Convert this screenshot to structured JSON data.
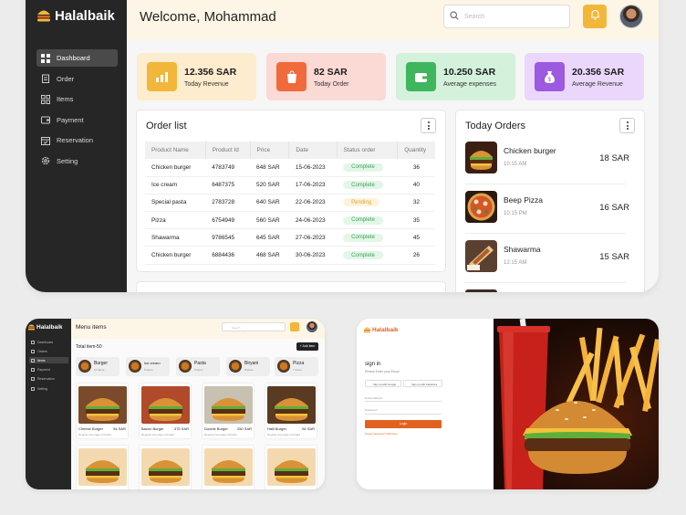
{
  "brand": {
    "name": "Halalbaik",
    "accent": "#f2b73a",
    "orange": "#e0621e"
  },
  "sidebar": {
    "items": [
      {
        "label": "Dashboard",
        "icon": "grid-icon",
        "active": true
      },
      {
        "label": "Order",
        "icon": "clipboard-icon"
      },
      {
        "label": "Items",
        "icon": "items-grid-icon"
      },
      {
        "label": "Payment",
        "icon": "wallet-icon"
      },
      {
        "label": "Reservation",
        "icon": "calendar-icon"
      },
      {
        "label": "Setting",
        "icon": "gear-icon"
      }
    ]
  },
  "header": {
    "welcome": "Welcome, Mohammad",
    "search_placeholder": "Search"
  },
  "stats": [
    {
      "value": "12.356 SAR",
      "label": "Today Revenue",
      "bg": "#fdeccd",
      "icon_bg": "#f2b73a"
    },
    {
      "value": "82 SAR",
      "label": "Today Order",
      "bg": "#fbd9d5",
      "icon_bg": "#f06a3c"
    },
    {
      "value": "10.250 SAR",
      "label": "Average expenses",
      "bg": "#d3f1db",
      "icon_bg": "#3fb55d"
    },
    {
      "value": "20.356 SAR",
      "label": "Average Revenue",
      "bg": "#ead7fb",
      "icon_bg": "#9b5ae0"
    }
  ],
  "order_list": {
    "title": "Order list",
    "columns": [
      "Product Name",
      "Product Id",
      "Price",
      "Date",
      "Status order",
      "Quantity"
    ],
    "rows": [
      {
        "name": "Chicken burger",
        "id": "4783749",
        "price": "648 SAR",
        "date": "15-06-2023",
        "status": "Complete",
        "qty": "36"
      },
      {
        "name": "Ice cream",
        "id": "6487375",
        "price": "520 SAR",
        "date": "17-06-2023",
        "status": "Complete",
        "qty": "40"
      },
      {
        "name": "Special pasta",
        "id": "2783728",
        "price": "640 SAR",
        "date": "22-06-2023",
        "status": "Pending",
        "qty": "32"
      },
      {
        "name": "Pizza",
        "id": "6754949",
        "price": "560 SAR",
        "date": "24-06-2023",
        "status": "Complete",
        "qty": "35"
      },
      {
        "name": "Shawarma",
        "id": "9786545",
        "price": "645 SAR",
        "date": "27-06-2023",
        "status": "Complete",
        "qty": "45"
      },
      {
        "name": "Chicken burger",
        "id": "6884436",
        "price": "468 SAR",
        "date": "30-06-2023",
        "status": "Complete",
        "qty": "26"
      }
    ]
  },
  "today_orders": {
    "title": "Today Orders",
    "items": [
      {
        "name": "Chicken burger",
        "time": "10:15 AM",
        "price": "18 SAR"
      },
      {
        "name": "Beep Pizza",
        "time": "10:15 PM",
        "price": "16 SAR"
      },
      {
        "name": "Shawarma",
        "time": "12:15 AM",
        "price": "15 SAR"
      }
    ]
  },
  "menu_screen": {
    "title": "Menu items",
    "total": "Total item-50",
    "add_button": "+ Add item",
    "nav": [
      "Dashboard",
      "Orders",
      "Items",
      "Payment",
      "Reservation",
      "Setting"
    ],
    "categories": [
      {
        "name": "Burger",
        "count": "10 items"
      },
      {
        "name": "Ice cream",
        "count": "6 items"
      },
      {
        "name": "Pasta",
        "count": "5 items"
      },
      {
        "name": "Biryani",
        "count": "8 items"
      },
      {
        "name": "Pizza",
        "count": "7 items"
      }
    ],
    "items": [
      {
        "name": "Cheese Burger",
        "price": "54 SAR",
        "sub": "Regular beverage included"
      },
      {
        "name": "Bacon Burger",
        "price": "375 SAR",
        "sub": "Regular beverage included"
      },
      {
        "name": "Double Burger",
        "price": "250 SAR",
        "sub": "Regular beverage included"
      },
      {
        "name": "Halli Burger",
        "price": "54 SAR",
        "sub": "Regular beverage included"
      }
    ]
  },
  "login_screen": {
    "title": "sign in",
    "subtitle": "Please Enter your Email",
    "google": "Sign up with Google",
    "facebook": "Sign up with Facebook",
    "email_label": "Email address",
    "password_label": "Password",
    "login_button": "Login",
    "forgot": "Forgot password? Click here"
  }
}
